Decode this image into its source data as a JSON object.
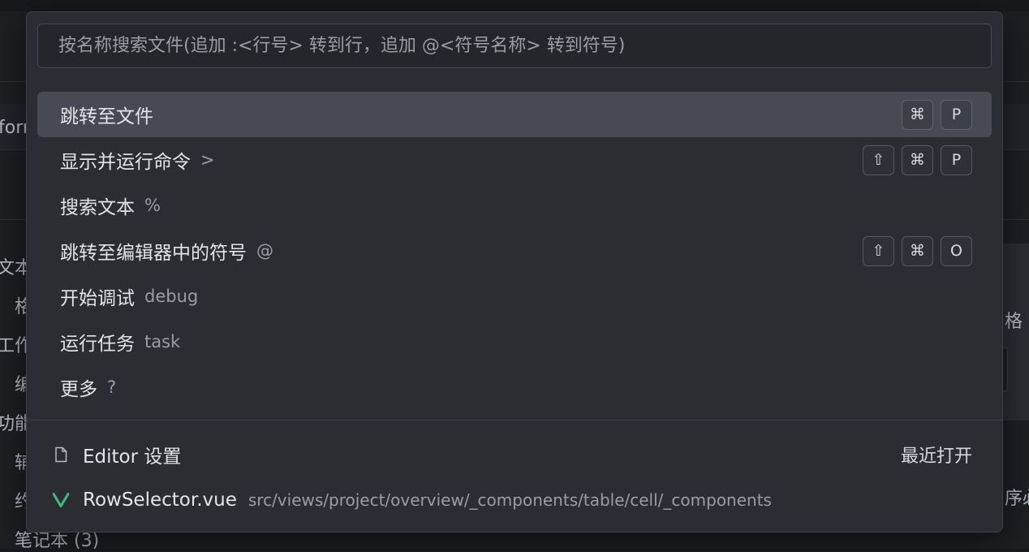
{
  "background": {
    "fragments": [
      "forr",
      "文本",
      "格",
      "工作",
      "编",
      "功能",
      "辅",
      "约",
      "笔记本 (3)",
      "格",
      "序必"
    ]
  },
  "search": {
    "value": "",
    "placeholder": "按名称搜索文件(追加 :<行号> 转到行，追加 @<符号名称> 转到符号)"
  },
  "commands": [
    {
      "label": "跳转至文件",
      "hint": "",
      "keys": [
        "⌘",
        "P"
      ],
      "active": true
    },
    {
      "label": "显示并运行命令",
      "hint": ">",
      "keys": [
        "⇧",
        "⌘",
        "P"
      ]
    },
    {
      "label": "搜索文本",
      "hint": "%",
      "keys": []
    },
    {
      "label": "跳转至编辑器中的符号",
      "hint": "@",
      "keys": [
        "⇧",
        "⌘",
        "O"
      ]
    },
    {
      "label": "开始调试",
      "hint": "debug",
      "keys": []
    },
    {
      "label": "运行任务",
      "hint": "task",
      "keys": []
    },
    {
      "label": "更多",
      "hint": "?",
      "keys": []
    }
  ],
  "recent": [
    {
      "icon": "file-icon",
      "name": "Editor 设置",
      "path": "",
      "tag": "最近打开"
    },
    {
      "icon": "vue-icon",
      "name": "RowSelector.vue",
      "path": "src/views/project/overview/_components/table/cell/_components",
      "tag": "",
      "icon_color": "#41b883"
    }
  ],
  "colors": {
    "palette_bg": "#2b2d33",
    "active_row": "#474a54",
    "vue_green": "#41b883"
  }
}
